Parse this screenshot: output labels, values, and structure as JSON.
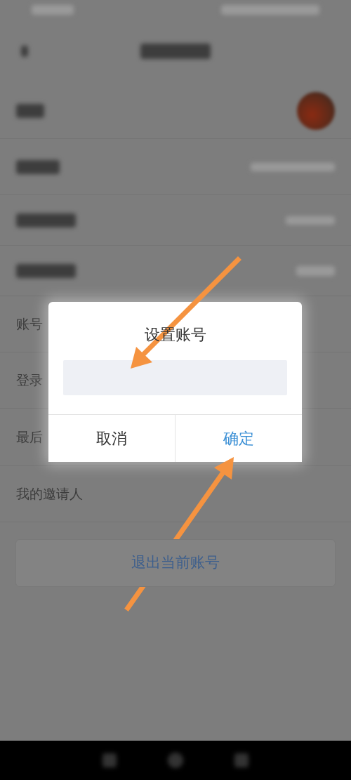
{
  "settings_rows": [
    {
      "label": "账号"
    },
    {
      "label": "登录"
    },
    {
      "label": "最后"
    },
    {
      "label": "我的邀请人"
    }
  ],
  "exit_button": {
    "label": "退出当前账号"
  },
  "dialog": {
    "title": "设置账号",
    "buttons": [
      {
        "label": "取消",
        "kind": "cancel"
      },
      {
        "label": "确定",
        "kind": "confirm"
      }
    ]
  }
}
